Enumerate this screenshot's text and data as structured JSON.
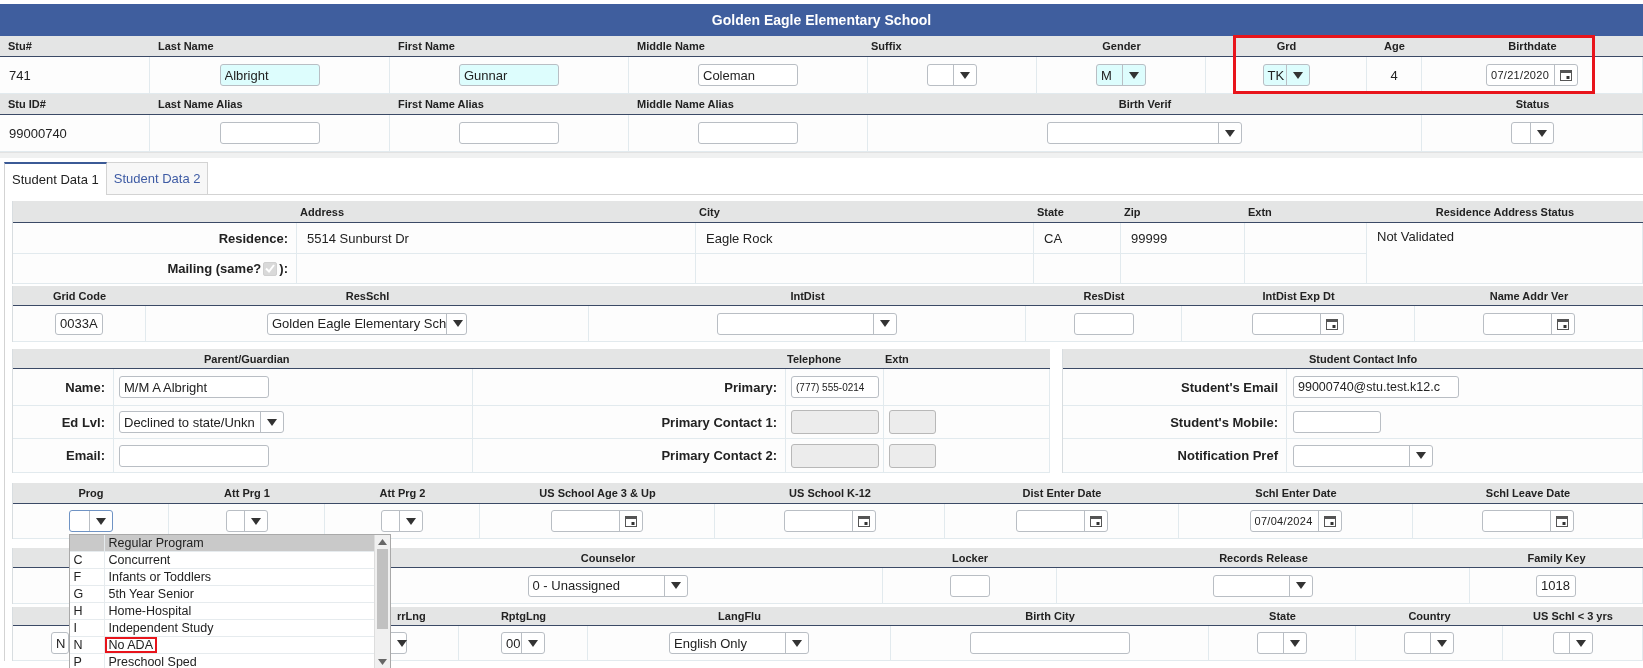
{
  "window": {
    "title": "Golden Eagle Elementary School"
  },
  "student_header": [
    {
      "columns": [
        {
          "label": "Stu#",
          "outlined": false
        },
        {
          "label": "Last Name",
          "outlined": false
        },
        {
          "label": "First Name",
          "outlined": false
        },
        {
          "label": "Middle Name",
          "outlined": false
        },
        {
          "label": "Suffix",
          "outlined": false
        },
        {
          "label": "Gender",
          "outlined": false
        },
        {
          "label": "Grd",
          "outlined": true
        },
        {
          "label": "Age",
          "outlined": true
        },
        {
          "label": "Birthdate",
          "outlined": true
        }
      ],
      "rows": [
        [
          {
            "kind": "text",
            "text": "741"
          },
          {
            "kind": "input",
            "value": "Albright",
            "highlighted": true
          },
          {
            "kind": "input",
            "value": "Gunnar",
            "highlighted": true
          },
          {
            "kind": "input",
            "value": "Coleman",
            "highlighted": false
          },
          {
            "kind": "select",
            "highlighted": false
          },
          {
            "kind": "select",
            "value": "M",
            "highlighted": true
          },
          {
            "kind": "select",
            "value": "TK",
            "highlighted": true
          },
          {
            "kind": "text",
            "text": "4"
          },
          {
            "kind": "date",
            "value": "07/21/2020"
          }
        ]
      ]
    },
    {
      "columns": [
        {
          "label": "Stu ID#"
        },
        {
          "label": "Last Name Alias"
        },
        {
          "label": "First Name Alias"
        },
        {
          "label": "Middle Name Alias"
        },
        {
          "label": "Birth Verif"
        },
        {
          "label": "Status"
        }
      ],
      "rows": [
        [
          {
            "kind": "text",
            "text": "99000740"
          },
          {
            "kind": "input",
            "highlighted": false
          },
          {
            "kind": "input",
            "highlighted": false
          },
          {
            "kind": "input",
            "highlighted": false
          },
          {
            "kind": "select",
            "highlighted": false
          },
          {
            "kind": "select",
            "highlighted": false
          }
        ]
      ]
    }
  ],
  "tabs": [
    {
      "label": "Student Data 1",
      "selected": true
    },
    {
      "label": "Student Data 2",
      "selected": false
    }
  ],
  "sections": [
    {
      "tables": [
        {
          "columns": [
            {},
            {
              "label": "Address"
            },
            {
              "label": "City"
            },
            {
              "label": "State"
            },
            {
              "label": "Zip"
            },
            {
              "label": "Extn"
            },
            {
              "label": "Residence Address Status"
            }
          ],
          "rows": [
            [
              {
                "kind": "label",
                "text": "Residence:"
              },
              {
                "kind": "text",
                "text": "5514 Sunburst Dr"
              },
              {
                "kind": "text",
                "text": "Eagle Rock"
              },
              {
                "kind": "text",
                "text": "CA"
              },
              {
                "kind": "text",
                "text": "99999"
              },
              {
                "kind": "empty"
              },
              {
                "kind": "text",
                "text": "Not Validated"
              }
            ],
            [
              {
                "kind": "label_check",
                "before": "Mailing (same?",
                "after": "):",
                "checked": true,
                "disabled": true
              },
              {
                "kind": "empty"
              },
              {
                "kind": "empty"
              },
              {
                "kind": "empty"
              },
              {
                "kind": "empty"
              },
              {
                "kind": "empty"
              }
            ]
          ]
        }
      ]
    },
    {
      "tables": [
        {
          "columns": [
            {
              "label": "Grid Code"
            },
            {
              "label": "ResSchl"
            },
            {
              "label": "IntDist"
            },
            {
              "label": "ResDist"
            },
            {
              "label": "IntDist Exp Dt"
            },
            {
              "label": "Name Addr Ver"
            }
          ],
          "rows": [
            [
              {
                "kind": "input",
                "value": "0033A"
              },
              {
                "kind": "select",
                "value": "Golden Eagle Elementary Sch"
              },
              {
                "kind": "select"
              },
              {
                "kind": "input"
              },
              {
                "kind": "date"
              },
              {
                "kind": "date"
              }
            ]
          ]
        }
      ]
    },
    {
      "tables": [
        {
          "columns": [
            {},
            {
              "label": "Parent/Guardian"
            },
            {},
            {
              "label": "Telephone"
            },
            {
              "label": "Extn"
            }
          ],
          "rows": [
            [
              {
                "kind": "label",
                "text": "Name:"
              },
              {
                "kind": "input",
                "value": "M/M A Albright",
                "disabled": false
              },
              {
                "kind": "label",
                "text": "Primary:"
              },
              {
                "kind": "input",
                "value": "(777) 555-0214",
                "disabled": false
              },
              {
                "kind": "empty"
              }
            ],
            [
              {
                "kind": "label",
                "text": "Ed Lvl:"
              },
              {
                "kind": "select",
                "value": "Declined to state/Unkn"
              },
              {
                "kind": "label",
                "text": "Primary Contact 1:"
              },
              {
                "kind": "input",
                "disabled": true
              },
              {
                "kind": "input",
                "disabled": true
              }
            ],
            [
              {
                "kind": "label",
                "text": "Email:"
              },
              {
                "kind": "input",
                "disabled": false
              },
              {
                "kind": "label",
                "text": "Primary Contact 2:"
              },
              {
                "kind": "input",
                "disabled": true
              },
              {
                "kind": "input",
                "disabled": true
              }
            ]
          ]
        },
        {
          "columns": [
            {},
            {
              "label": "Student Contact Info"
            }
          ],
          "rows": [
            [
              {
                "kind": "label",
                "text": "Student's Email"
              },
              {
                "kind": "input",
                "value": "99000740@stu.test.k12.c"
              }
            ],
            [
              {
                "kind": "label",
                "text": "Student's Mobile:"
              },
              {
                "kind": "input"
              }
            ],
            [
              {
                "kind": "label",
                "text": "Notification Pref"
              },
              {
                "kind": "select"
              }
            ]
          ]
        }
      ]
    },
    {
      "tables": [
        {
          "columns": [
            {
              "label": "Prog"
            },
            {
              "label": "Att Prg 1"
            },
            {
              "label": "Att Prg 2"
            },
            {
              "label": "US School Age 3 & Up"
            },
            {
              "label": "US School K-12"
            },
            {
              "label": "Dist Enter Date"
            },
            {
              "label": "Schl Enter Date"
            },
            {
              "label": "Schl Leave Date"
            }
          ],
          "rows": [
            [
              {
                "kind": "select",
                "open": true,
                "options": [
                  {
                    "label": "Regular Program",
                    "selected": true,
                    "outlined": false
                  },
                  {
                    "code": "C",
                    "label": "Concurrent",
                    "selected": false,
                    "outlined": false
                  },
                  {
                    "code": "F",
                    "label": "Infants or Toddlers",
                    "selected": false,
                    "outlined": false
                  },
                  {
                    "code": "G",
                    "label": "5th Year Senior",
                    "selected": false,
                    "outlined": false
                  },
                  {
                    "code": "H",
                    "label": "Home-Hospital",
                    "selected": false,
                    "outlined": false
                  },
                  {
                    "code": "I",
                    "label": "Independent Study",
                    "selected": false,
                    "outlined": false
                  },
                  {
                    "code": "N",
                    "label": "No ADA",
                    "selected": false,
                    "outlined": true
                  },
                  {
                    "code": "P",
                    "label": "Preschool Sped",
                    "selected": false,
                    "outlined": false
                  }
                ]
              },
              {
                "kind": "select"
              },
              {
                "kind": "select"
              },
              {
                "kind": "date"
              },
              {
                "kind": "date"
              },
              {
                "kind": "date"
              },
              {
                "kind": "date",
                "value": "07/04/2024"
              },
              {
                "kind": "date"
              }
            ]
          ]
        }
      ]
    },
    {
      "tables": [
        {
          "columns": [
            {},
            {
              "label": "Counselor"
            },
            {
              "label": "Locker"
            },
            {
              "label": "Records Release"
            },
            {
              "label": "Family Key"
            }
          ],
          "rows": [
            [
              {
                "kind": "empty"
              },
              {
                "kind": "select",
                "value": "0 - Unassigned"
              },
              {
                "kind": "input"
              },
              {
                "kind": "select"
              },
              {
                "kind": "input",
                "value": "1018"
              }
            ]
          ]
        }
      ]
    },
    {
      "tables": [
        {
          "columns": [
            {},
            {
              "label": "rrLng"
            },
            {
              "label": "RptgLng"
            },
            {
              "label": "LangFlu"
            },
            {
              "label": "Birth City"
            },
            {
              "label": "State"
            },
            {
              "label": "Country"
            },
            {
              "label": "US Schl < 3 yrs"
            }
          ],
          "rows": [
            [
              {
                "kind": "select",
                "value": "N"
              },
              {
                "kind": "select"
              },
              {
                "kind": "select",
                "value": "00"
              },
              {
                "kind": "select",
                "value": "English Only"
              },
              {
                "kind": "input"
              },
              {
                "kind": "select"
              },
              {
                "kind": "select"
              },
              {
                "kind": "select"
              }
            ]
          ]
        }
      ]
    }
  ]
}
